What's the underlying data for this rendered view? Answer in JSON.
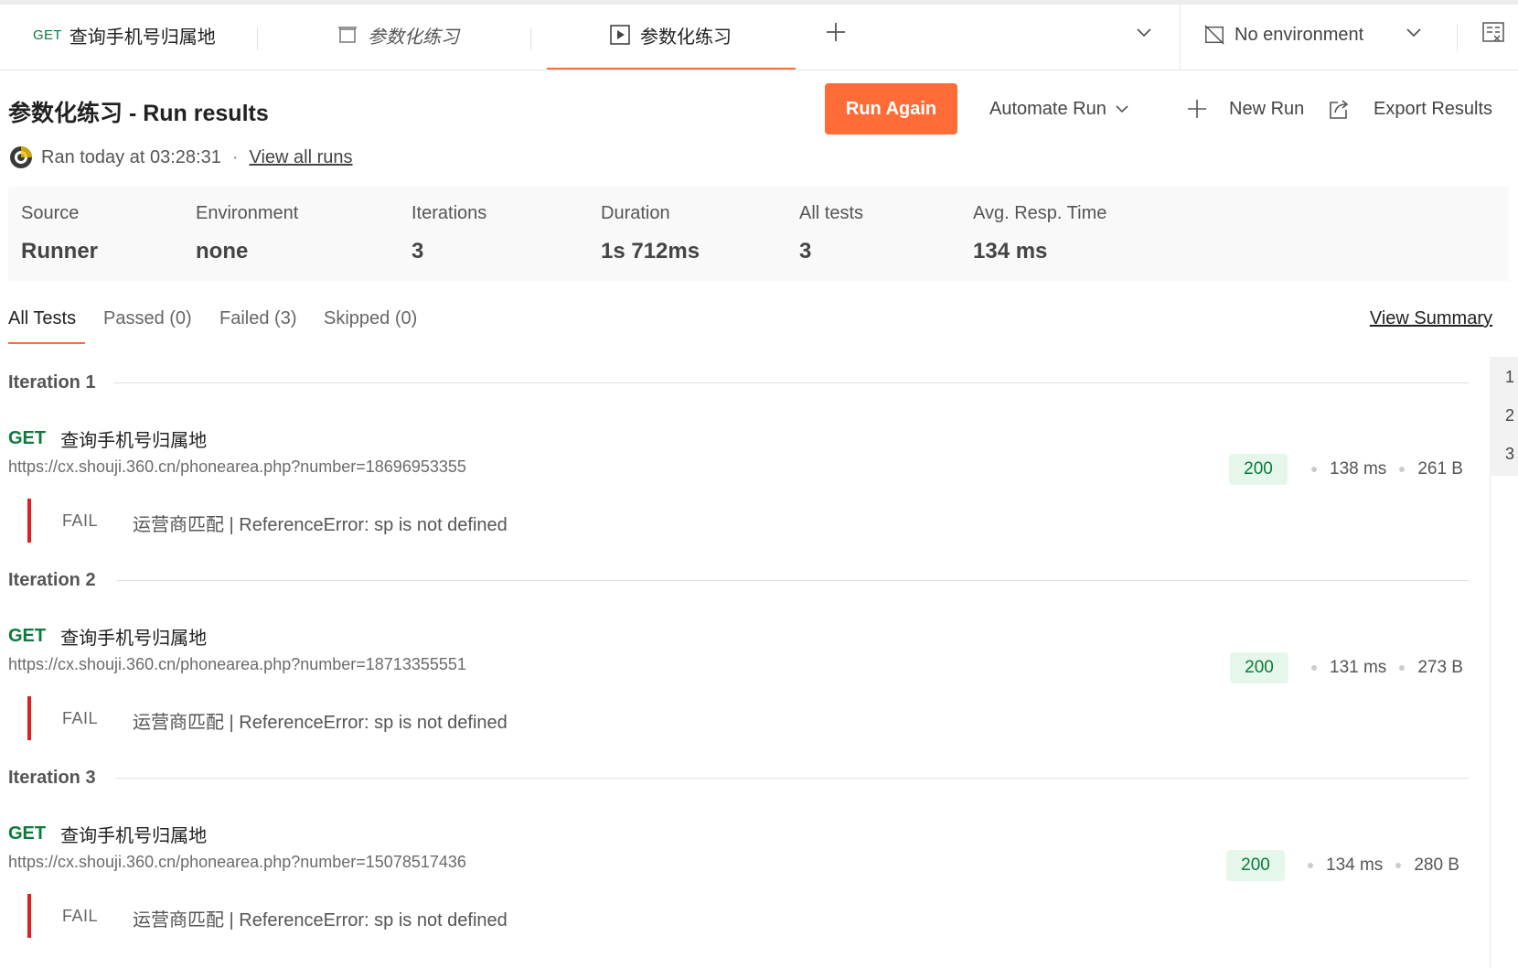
{
  "tabs": [
    {
      "method": "GET",
      "label": "查询手机号归属地"
    },
    {
      "label": "参数化练习"
    },
    {
      "label": "参数化练习"
    }
  ],
  "environment": {
    "label": "No environment"
  },
  "header": {
    "title": "参数化练习 - Run results",
    "run_again": "Run Again",
    "automate_run": "Automate Run",
    "new_run": "New Run",
    "export_results": "Export Results",
    "ran_text": "Ran today at 03:28:31",
    "view_all_runs": "View all runs"
  },
  "stats": [
    {
      "label": "Source",
      "value": "Runner"
    },
    {
      "label": "Environment",
      "value": "none"
    },
    {
      "label": "Iterations",
      "value": "3"
    },
    {
      "label": "Duration",
      "value": "1s 712ms"
    },
    {
      "label": "All tests",
      "value": "3"
    },
    {
      "label": "Avg. Resp. Time",
      "value": "134 ms"
    }
  ],
  "filters": {
    "all": "All Tests",
    "passed": "Passed (0)",
    "failed": "Failed (3)",
    "skipped": "Skipped (0)",
    "view_summary": "View Summary"
  },
  "iterations": [
    {
      "title": "Iteration 1",
      "method": "GET",
      "name": "查询手机号归属地",
      "url": "https://cx.shouji.360.cn/phonearea.php?number=18696953355",
      "status": "200",
      "time": "138 ms",
      "size": "261 B",
      "result": "FAIL",
      "message": "运营商匹配 | ReferenceError: sp is not defined"
    },
    {
      "title": "Iteration 2",
      "method": "GET",
      "name": "查询手机号归属地",
      "url": "https://cx.shouji.360.cn/phonearea.php?number=18713355551",
      "status": "200",
      "time": "131 ms",
      "size": "273 B",
      "result": "FAIL",
      "message": "运营商匹配 | ReferenceError: sp is not defined"
    },
    {
      "title": "Iteration 3",
      "method": "GET",
      "name": "查询手机号归属地",
      "url": "https://cx.shouji.360.cn/phonearea.php?number=15078517436",
      "status": "200",
      "time": "134 ms",
      "size": "280 B",
      "result": "FAIL",
      "message": "运营商匹配 | ReferenceError: sp is not defined"
    }
  ],
  "iteration_index": [
    "1",
    "2",
    "3"
  ],
  "colors": {
    "accent": "#ff6c37",
    "get": "#0b7a3b",
    "fail": "#e02020",
    "status_bg": "#e5f7ea"
  }
}
